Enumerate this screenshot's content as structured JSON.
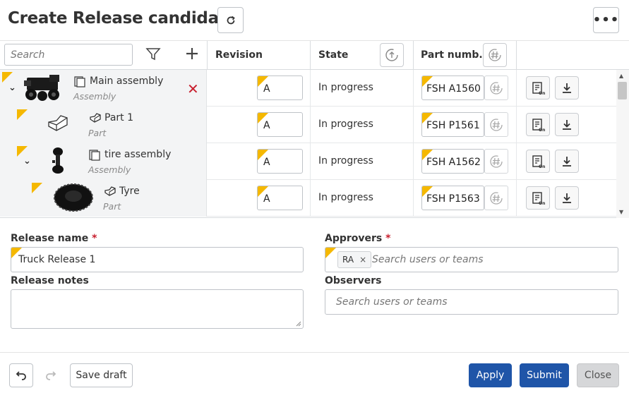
{
  "header": {
    "title": "Create Release candidate",
    "more_label": "•••"
  },
  "table": {
    "search_placeholder": "Search",
    "columns": {
      "revision": "Revision",
      "state": "State",
      "part_number": "Part numb..."
    },
    "rows": [
      {
        "name": "Main assembly",
        "type": "Assembly",
        "revision": "A",
        "state": "In progress",
        "part_number": "FSH A1560"
      },
      {
        "name": "Part 1",
        "type": "Part",
        "revision": "A",
        "state": "In progress",
        "part_number": "FSH P1561"
      },
      {
        "name": "tire assembly",
        "type": "Assembly",
        "revision": "A",
        "state": "In progress",
        "part_number": "FSH A1562"
      },
      {
        "name": "Tyre",
        "type": "Part",
        "revision": "A",
        "state": "In progress",
        "part_number": "FSH P1563"
      }
    ]
  },
  "form": {
    "release_name_label": "Release name",
    "release_name_value": "Truck Release 1",
    "release_notes_label": "Release notes",
    "approvers_label": "Approvers",
    "approvers_placeholder": "Search users or teams",
    "approver_chip": "RA",
    "observers_label": "Observers",
    "observers_placeholder": "Search users or teams",
    "required_marker": "*"
  },
  "footer": {
    "save_draft": "Save draft",
    "apply": "Apply",
    "submit": "Submit",
    "close": "Close"
  },
  "colors": {
    "primary": "#1f55a8",
    "flag": "#f5b800",
    "remove": "#c8202f"
  }
}
